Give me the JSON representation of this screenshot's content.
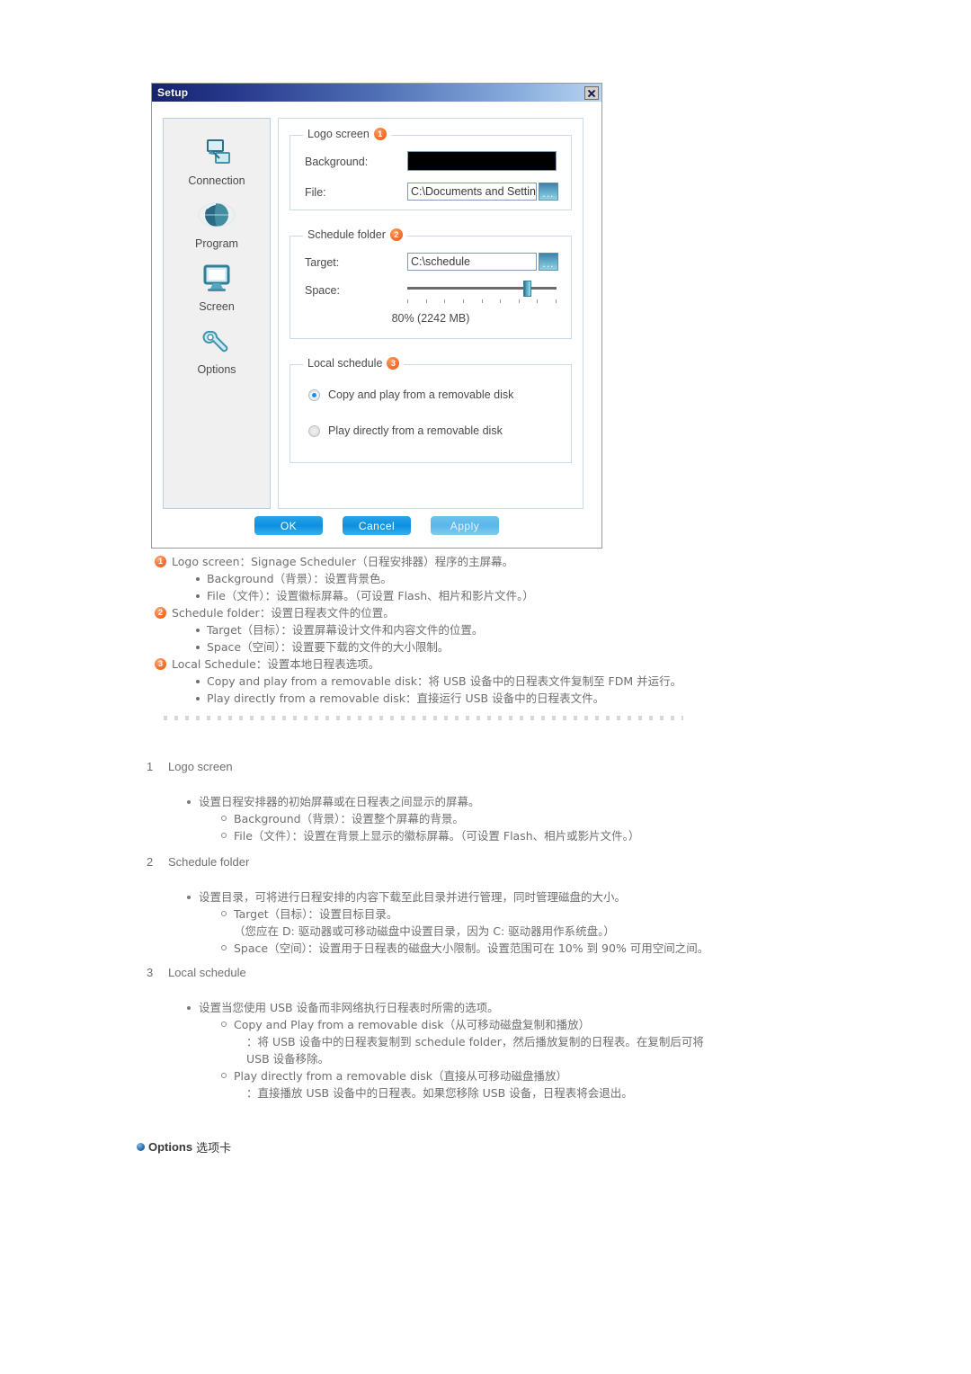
{
  "dialog": {
    "title": "Setup",
    "close_icon": "close-icon",
    "nav": [
      {
        "label": "Connection",
        "icon": "connection-icon"
      },
      {
        "label": "Program",
        "icon": "globe-icon"
      },
      {
        "label": "Screen",
        "icon": "monitor-icon"
      },
      {
        "label": "Options",
        "icon": "wrench-icon"
      }
    ],
    "groups": [
      {
        "legend": "Logo screen",
        "badge": "1",
        "fields": {
          "background_label": "Background:",
          "background_color": "#000000",
          "file_label": "File:",
          "file_value": "C:\\Documents and Settings",
          "browse_label": "..."
        }
      },
      {
        "legend": "Schedule folder",
        "badge": "2",
        "fields": {
          "target_label": "Target:",
          "target_value": "C:\\schedule",
          "browse_label": "...",
          "space_label": "Space:",
          "space_value_text": "80% (2242 MB)",
          "space_percent": 80
        }
      },
      {
        "legend": "Local schedule",
        "badge": "3",
        "options": [
          {
            "label": "Copy and play from a removable disk",
            "selected": true
          },
          {
            "label": "Play directly from a removable disk",
            "selected": false
          }
        ]
      }
    ],
    "buttons": [
      {
        "label": "OK",
        "state": "enabled"
      },
      {
        "label": "Cancel",
        "state": "enabled"
      },
      {
        "label": "Apply",
        "state": "disabled"
      }
    ]
  },
  "legend": {
    "items": [
      {
        "badge": "1",
        "text": "Logo screen：Signage Scheduler（日程安排器）程序的主屏幕。",
        "subs": [
          "Background（背景）：设置背景色。",
          "File（文件）：设置徽标屏幕。（可设置 Flash、相片和影片文件。）"
        ]
      },
      {
        "badge": "2",
        "text": "Schedule folder：设置日程表文件的位置。",
        "subs": [
          "Target（目标）：设置屏幕设计文件和内容文件的位置。",
          "Space（空间）：设置要下载的文件的大小限制。"
        ]
      },
      {
        "badge": "3",
        "text": "Local Schedule：设置本地日程表选项。",
        "subs": [
          "Copy and play from a removable disk：将 USB 设备中的日程表文件复制至 FDM 并运行。",
          "Play directly from a removable disk：直接运行 USB 设备中的日程表文件。"
        ]
      }
    ]
  },
  "sections": [
    {
      "num": "1",
      "title": "Logo screen",
      "bullet": "设置日程安排器的初始屏幕或在日程表之间显示的屏幕。",
      "subs": [
        "Background（背景）：设置整个屏幕的背景。",
        "File（文件）：设置在背景上显示的徽标屏幕。（可设置 Flash、相片或影片文件。）"
      ]
    },
    {
      "num": "2",
      "title": "Schedule folder",
      "bullet": "设置目录，可将进行日程安排的内容下载至此目录并进行管理，同时管理磁盘的大小。",
      "subs": [
        "Target（目标）：设置目标目录。",
        "Space（空间）：设置用于日程表的磁盘大小限制。设置范围可在 10% 到 90% 可用空间之间。"
      ],
      "note": "（您应在 D: 驱动器或可移动磁盘中设置目录，因为 C: 驱动器用作系统盘。）"
    },
    {
      "num": "3",
      "title": "Local schedule",
      "bullet": "设置当您使用 USB 设备而非网络执行日程表时所需的选项。",
      "subs": [
        "Copy and Play from a removable disk（从可移动磁盘复制和播放）",
        "Play directly from a removable disk（直接从可移动磁盘播放）"
      ],
      "detail1": "：将 USB 设备中的日程表复制到 schedule folder，然后播放复制的日程表。在复制后可将 USB 设备移除。",
      "detail2": "：直接播放 USB 设备中的日程表。如果您移除 USB 设备，日程表将会退出。"
    }
  ],
  "options_heading": {
    "dot": "bullet-dot-icon",
    "english": "Options",
    "chinese": "选项卡"
  }
}
